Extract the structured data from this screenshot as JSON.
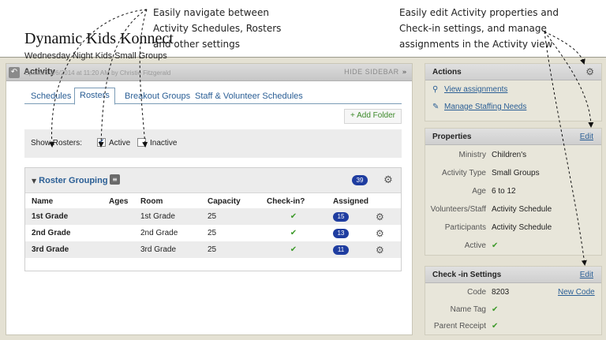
{
  "callouts": {
    "left": [
      "Easily navigate between",
      "Activity Schedules, Rosters",
      "and other settings"
    ],
    "right": [
      "Easily edit Activity properties and",
      "Check-in settings, and manage",
      "assignments in the Activity view"
    ]
  },
  "main": {
    "header_title": "Activity",
    "hide_sidebar": "HIDE SIDEBAR",
    "activity_name": "Dynamic Kids Konnect",
    "activity_subtitle": "Wednesday Night Kids Small Groups",
    "updated": "Updated 8/6/2014 at 11:20 AM by Christie Fitzgerald",
    "tabs": [
      {
        "label": "Schedules"
      },
      {
        "label": "Rosters"
      },
      {
        "label": "Breakout Groups"
      },
      {
        "label": "Staff & Volunteer Schedules"
      }
    ],
    "active_tab": "Rosters",
    "add_folder": "+ Add Folder",
    "show_rosters": {
      "label": "Show Rosters:",
      "active_label": "Active",
      "active_checked": true,
      "inactive_label": "Inactive",
      "inactive_checked": false
    },
    "roster_group": {
      "title": "Roster Grouping",
      "count": "39",
      "columns": [
        "Name",
        "Ages",
        "Room",
        "Capacity",
        "Check-in?",
        "Assigned"
      ],
      "rows": [
        {
          "name": "1st Grade",
          "ages": "",
          "room": "1st Grade",
          "capacity": "25",
          "checkin": "✔",
          "assigned": "15"
        },
        {
          "name": "2nd Grade",
          "ages": "",
          "room": "2nd Grade",
          "capacity": "25",
          "checkin": "✔",
          "assigned": "13"
        },
        {
          "name": "3rd Grade",
          "ages": "",
          "room": "3rd Grade",
          "capacity": "25",
          "checkin": "✔",
          "assigned": "11"
        }
      ]
    }
  },
  "sidebar": {
    "actions": {
      "title": "Actions",
      "links": [
        {
          "label": "View assignments",
          "icon": "search-icon"
        },
        {
          "label": "Manage Staffing Needs",
          "icon": "wrench-icon"
        }
      ]
    },
    "properties": {
      "title": "Properties",
      "edit": "Edit",
      "rows": [
        {
          "label": "Ministry",
          "value": "Children's"
        },
        {
          "label": "Activity Type",
          "value": "Small Groups"
        },
        {
          "label": "Age",
          "value": "6 to 12"
        },
        {
          "label": "Volunteers/Staff",
          "value": "Activity Schedule"
        },
        {
          "label": "Participants",
          "value": "Activity Schedule"
        },
        {
          "label": "Active",
          "value": "✔"
        }
      ]
    },
    "checkin": {
      "title": "Check -in Settings",
      "edit": "Edit",
      "rows": [
        {
          "label": "Code",
          "value": "8203",
          "link": "New Code"
        },
        {
          "label": "Name Tag",
          "value": "✔"
        },
        {
          "label": "Parent Receipt",
          "value": "✔"
        }
      ]
    }
  },
  "colors": {
    "link": "#2a5e95",
    "badge": "#1f3da0",
    "check": "#3d9a2a",
    "frame": "#e4e1d3"
  }
}
